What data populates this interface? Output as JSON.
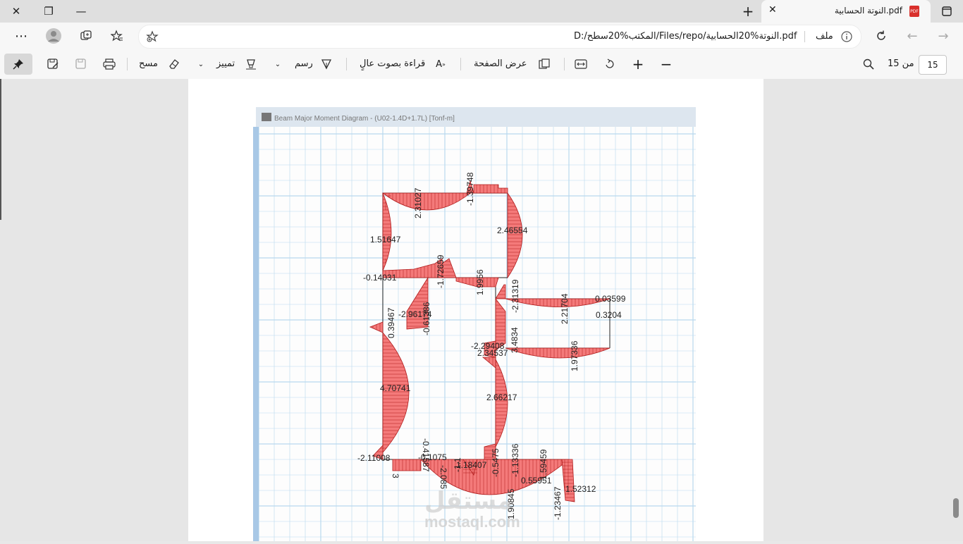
{
  "window": {
    "tab_title": "النوتة الحسابية.pdf",
    "pdf_icon_text": "PDF"
  },
  "address": {
    "file_label": "ملف",
    "url": "D:/المكتب%20سطح/Files/repo/النوتة%20الحسابية.pdf"
  },
  "toolbar": {
    "page_number": "15",
    "page_of": "من 15",
    "page_view_label": "عرض الصفحة",
    "read_aloud_label": "قراءة بصوت عالٍ",
    "draw_label": "رسم",
    "highlight_label": "تمييز",
    "erase_label": "مسح"
  },
  "figure": {
    "window_title": "Beam Major Moment Diagram - (U02-1.4D+1.7L)  [Tonf-m]",
    "labels": [
      "2.31027",
      "-1.39748",
      "2.46554",
      "1.51647",
      "-0.14031",
      "-1.72659",
      "1.9956",
      "-2.31319",
      "2.21704",
      "0.03599",
      "0.3204",
      "0.39467",
      "-2.96174",
      "-0.61386",
      "-2.29408",
      "2.34537",
      "3.4834",
      "1.97336",
      "4.70741",
      "2.66217",
      "-2.11008",
      "-0.41587",
      "-0.1075",
      "1.18407",
      "-0.5475",
      "-1.13336",
      "1.59459",
      "0.55951",
      "-1.23467",
      "1.52312",
      "1.90845",
      "3",
      "-2.085",
      "-1.1"
    ],
    "watermark_text": "mostaql.com",
    "watermark_logo": "مستقل"
  },
  "colors": {
    "diagram_fill": "#f47a7a",
    "diagram_stroke": "#b01a1a",
    "grid_line": "#b9d9ef"
  }
}
